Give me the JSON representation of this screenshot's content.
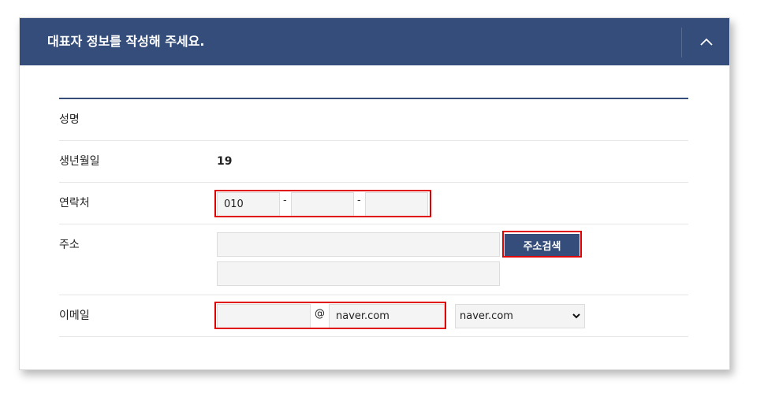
{
  "header": {
    "title": "대표자 정보를 작성해 주세요.",
    "collapse_icon": "chevron-up-icon"
  },
  "form": {
    "name": {
      "label": "성명",
      "value": ""
    },
    "birth": {
      "label": "생년월일",
      "value": "19"
    },
    "phone": {
      "label": "연락처",
      "part1": "010",
      "part2": "",
      "part3": "",
      "separator": "-"
    },
    "address": {
      "label": "주소",
      "line1": "",
      "line2": "",
      "search_button": "주소검색"
    },
    "email": {
      "label": "이메일",
      "local": "",
      "at": "@",
      "domain": "naver.com",
      "domain_select": "naver.com",
      "select_icon": "chevron-down-icon"
    }
  },
  "colors": {
    "header_bg": "#354d7a",
    "highlight": "#e00000",
    "button_bg": "#354d7a"
  }
}
